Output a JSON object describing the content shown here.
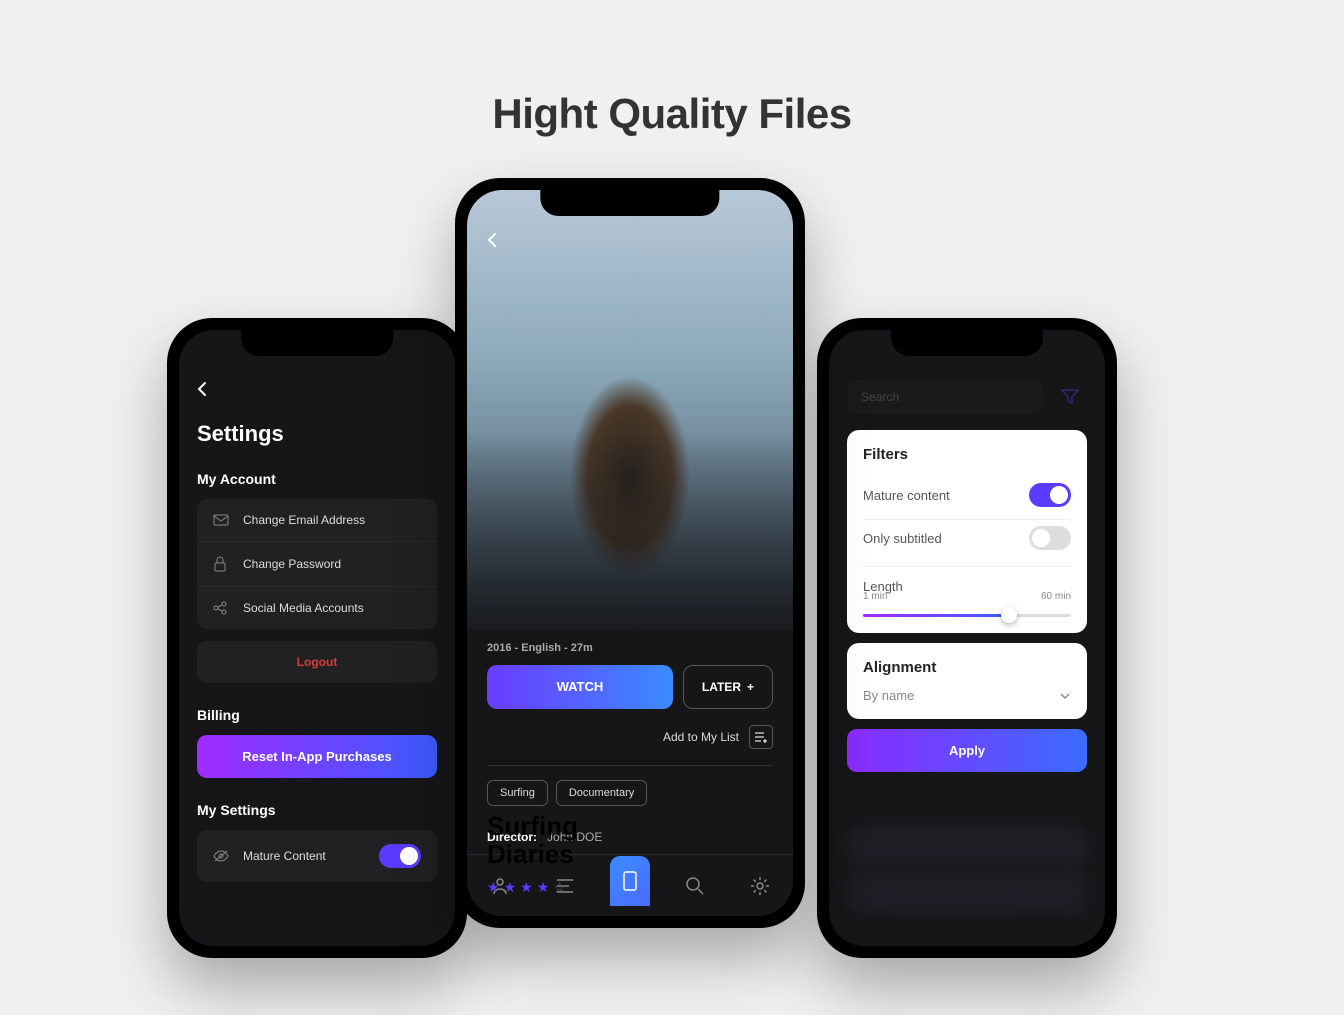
{
  "pageTitle": "Hight Quality Files",
  "left": {
    "title": "Settings",
    "account": {
      "heading": "My Account",
      "items": [
        {
          "icon": "mail",
          "label": "Change Email Address"
        },
        {
          "icon": "lock",
          "label": "Change Password"
        },
        {
          "icon": "share",
          "label": "Social Media Accounts"
        }
      ],
      "logout": "Logout"
    },
    "billing": {
      "heading": "Billing",
      "reset": "Reset In-App Purchases"
    },
    "mysettings": {
      "heading": "My Settings",
      "mature": "Mature Content"
    }
  },
  "center": {
    "title": "Surfing\nDiaries",
    "rating": 4,
    "meta": "2016 - English - 27m",
    "watch": "WATCH",
    "later": "LATER",
    "addList": "Add to My List",
    "tags": [
      "Surfing",
      "Documentary"
    ],
    "directorLabel": "Director:",
    "directorName": "John DOE"
  },
  "right": {
    "search": "Search",
    "filters": {
      "title": "Filters",
      "mature": "Mature content",
      "subtitled": "Only subtitled",
      "length": "Length",
      "min": "1 min",
      "max": "60 min"
    },
    "alignment": {
      "title": "Alignment",
      "value": "By name"
    },
    "apply": "Apply"
  }
}
